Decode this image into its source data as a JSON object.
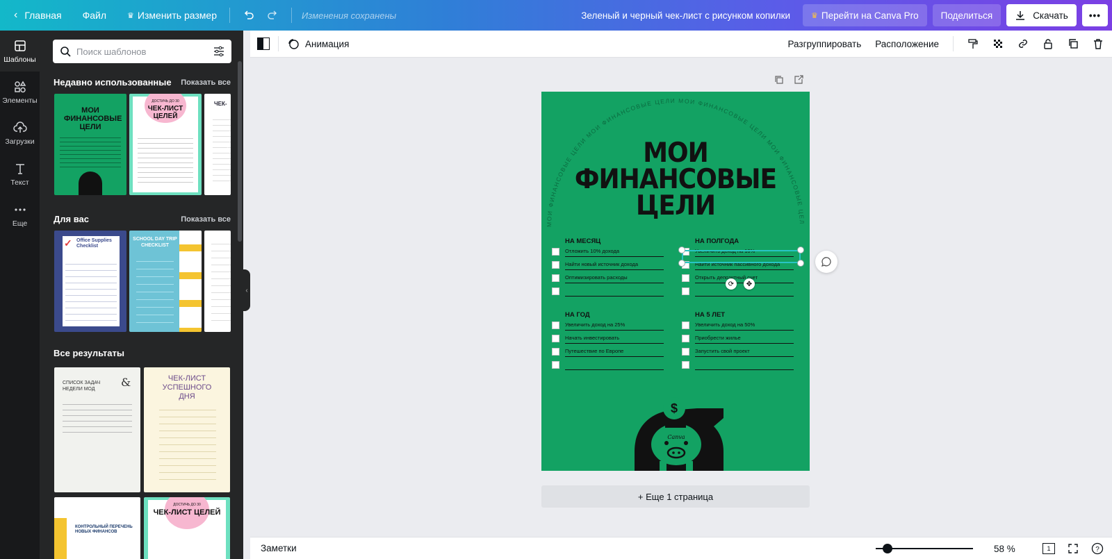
{
  "topbar": {
    "home": "Главная",
    "file": "Файл",
    "resize": "Изменить размер",
    "saved": "Изменения сохранены",
    "doc_title": "Зеленый и черный чек-лист с рисунком копилки",
    "pro": "Перейти на Canva Pro",
    "share": "Поделиться",
    "download": "Скачать",
    "more": "•••"
  },
  "rail": {
    "items": [
      {
        "label": "Шаблоны",
        "icon": "templates-icon"
      },
      {
        "label": "Элементы",
        "icon": "elements-icon"
      },
      {
        "label": "Загрузки",
        "icon": "upload-icon"
      },
      {
        "label": "Текст",
        "icon": "text-icon"
      },
      {
        "label": "Еще",
        "icon": "more-icon"
      }
    ]
  },
  "panel": {
    "search_placeholder": "Поиск шаблонов",
    "recent_title": "Недавно использованные",
    "recent_link": "Показать все",
    "foryou_title": "Для вас",
    "foryou_link": "Показать все",
    "all_title": "Все результаты",
    "thumbs": {
      "t1_title": "МОИ ФИНАНСОВЫЕ ЦЕЛИ",
      "t2_sub": "ДОСТИЧЬ ДО 30",
      "t2_title": "ЧЕК-ЛИСТ ЦЕЛЕЙ",
      "t3_title": "ЧЕК-",
      "f1_title": "Office Supplies Checklist",
      "f2_title": "SCHOOL DAY TRIP CHECKLIST",
      "a1_title": "СПИСОК ЗАДАЧ НЕДЕЛИ МОД",
      "a2_title": "ЧЕК-ЛИСТ УСПЕШНОГО ДНЯ",
      "a3_title": "КОНТРОЛЬНЫЙ ПЕРЕЧЕНЬ НОВЫХ ФИНАНСОВ",
      "a4_sub": "ДОСТИЧЬ ДО 30",
      "a4_title": "ЧЕК-ЛИСТ ЦЕЛЕЙ"
    }
  },
  "editor_toolbar": {
    "animation": "Анимация",
    "ungroup": "Разгруппировать",
    "position": "Расположение"
  },
  "design": {
    "arc_text": "МОИ ФИНАНСОВЫЕ ЦЕЛИ МОИ ФИНАНСОВЫЕ ЦЕЛИ МОИ ФИНАНСОВЫЕ ЦЕЛИ МОИ ФИНАНСОВЫЕ ЦЕЛИ",
    "title1": "МОИ",
    "title2": "ФИНАНСОВЫЕ",
    "title3": "ЦЕЛИ",
    "month_head": "НА МЕСЯЦ",
    "month_items": [
      "Отложить 10% дохода",
      "Найти новый источник дохода",
      "Оптимизировать расходы",
      ""
    ],
    "half_head": "НА ПОЛГОДА",
    "half_items": [
      "Увеличить доход на 10%",
      "Найти источник пассивного дохода",
      "Открыть депозитный счет",
      ""
    ],
    "year_head": "НА ГОД",
    "year_items": [
      "Увеличить доход на 25%",
      "Начать инвестировать",
      "Путешествие по Европе",
      ""
    ],
    "five_head": "НА 5 ЛЕТ",
    "five_items": [
      "Увеличить доход на 50%",
      "Приобрести жилье",
      "Запустить свой проект",
      ""
    ],
    "logo": "Canva",
    "bg_color": "#13a263"
  },
  "add_page": "+ Еще 1 страница",
  "bottombar": {
    "notes": "Заметки",
    "zoom": "58 %",
    "page_count": "1"
  }
}
